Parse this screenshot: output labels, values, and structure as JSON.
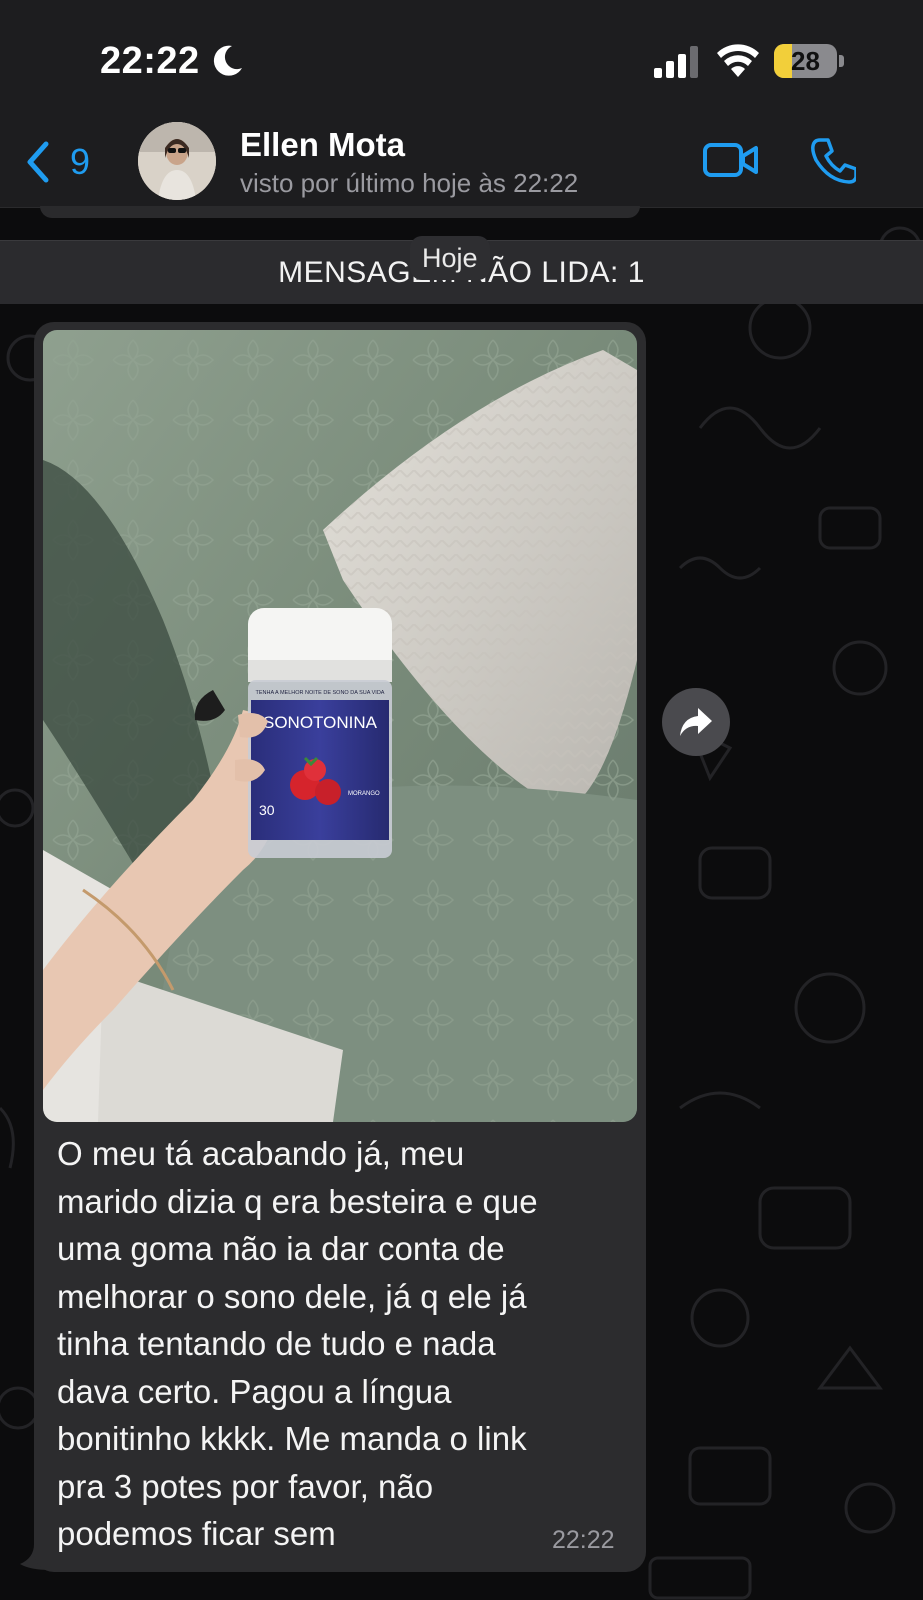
{
  "status_bar": {
    "time": "22:22",
    "battery_level": "28",
    "battery_fraction": 0.28
  },
  "header": {
    "back_count": "9",
    "contact_name": "Ellen Mota",
    "contact_status": "visto por último hoje às 22:22"
  },
  "chat": {
    "unread_banner": "MENSAGEM NÃO LIDA: 1",
    "date_pill": "Hoje",
    "message": {
      "text": "O meu tá acabando já, meu\nmarido dizia q era besteira e que\numa goma não ia dar conta de\nmelhorar o sono dele, já q ele já\ntinha tentando de tudo e nada\ndava certo. Pagou a língua\nbonitinho kkkk. Me manda o link\npra 3 potes por favor, não\npodemos ficar sem",
      "time": "22:22",
      "photo": {
        "product_brand": "SONOTONINA",
        "product_tagline": "TENHA A MELHOR NOITE DE SONO DA SUA VIDA",
        "product_count": "30",
        "product_flavor": "MORANGO"
      }
    }
  },
  "colors": {
    "accent_blue": "#1f9cf0",
    "bubble_bg": "#2c2c2e",
    "header_bg": "#1d1d1f",
    "battery_yellow": "#f2cf3a"
  },
  "icons": [
    "moon-icon",
    "signal-icon",
    "wifi-icon",
    "chevron-left-icon",
    "video-camera-icon",
    "phone-icon",
    "forward-icon"
  ]
}
